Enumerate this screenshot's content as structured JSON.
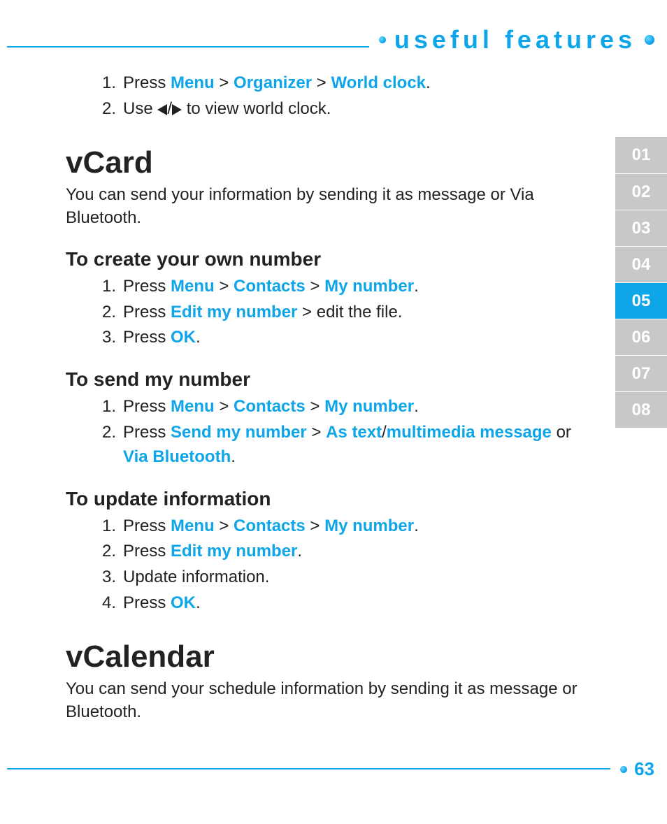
{
  "header": {
    "title": "useful features"
  },
  "intro_list": [
    {
      "n": "1.",
      "segments": [
        {
          "t": "Press ",
          "k": false
        },
        {
          "t": "Menu",
          "k": true
        },
        {
          "t": " > ",
          "k": false
        },
        {
          "t": "Organizer",
          "k": true
        },
        {
          "t": " > ",
          "k": false
        },
        {
          "t": "World clock",
          "k": true
        },
        {
          "t": ".",
          "k": false
        }
      ]
    },
    {
      "n": "2.",
      "segments": [
        {
          "t": "Use ",
          "k": false
        },
        {
          "icon": "tri-left"
        },
        {
          "t": "/",
          "k": false
        },
        {
          "icon": "tri-right"
        },
        {
          "t": " to view world clock.",
          "k": false
        }
      ]
    }
  ],
  "sections": [
    {
      "h1": "vCard",
      "desc": "You can send your information by sending it as message or Via Bluetooth.",
      "subs": [
        {
          "h2": "To create your own number",
          "items": [
            {
              "n": "1.",
              "segments": [
                {
                  "t": "Press ",
                  "k": false
                },
                {
                  "t": "Menu",
                  "k": true
                },
                {
                  "t": " > ",
                  "k": false
                },
                {
                  "t": "Contacts",
                  "k": true
                },
                {
                  "t": " > ",
                  "k": false
                },
                {
                  "t": "My number",
                  "k": true
                },
                {
                  "t": ".",
                  "k": false
                }
              ]
            },
            {
              "n": "2.",
              "segments": [
                {
                  "t": "Press ",
                  "k": false
                },
                {
                  "t": "Edit my number",
                  "k": true
                },
                {
                  "t": " > edit the file.",
                  "k": false
                }
              ]
            },
            {
              "n": "3.",
              "segments": [
                {
                  "t": "Press ",
                  "k": false
                },
                {
                  "t": "OK",
                  "k": true
                },
                {
                  "t": ".",
                  "k": false
                }
              ]
            }
          ]
        },
        {
          "h2": "To send my number",
          "items": [
            {
              "n": "1.",
              "segments": [
                {
                  "t": "Press ",
                  "k": false
                },
                {
                  "t": "Menu",
                  "k": true
                },
                {
                  "t": " > ",
                  "k": false
                },
                {
                  "t": "Contacts",
                  "k": true
                },
                {
                  "t": " > ",
                  "k": false
                },
                {
                  "t": "My number",
                  "k": true
                },
                {
                  "t": ".",
                  "k": false
                }
              ]
            },
            {
              "n": "2.",
              "segments": [
                {
                  "t": "Press ",
                  "k": false
                },
                {
                  "t": "Send my number",
                  "k": true
                },
                {
                  "t": " > ",
                  "k": false
                },
                {
                  "t": "As text",
                  "k": true
                },
                {
                  "t": "/",
                  "k": false
                },
                {
                  "t": "multimedia message",
                  "k": true
                },
                {
                  "t": " or ",
                  "k": false
                },
                {
                  "t": "Via Bluetooth",
                  "k": true
                },
                {
                  "t": ".",
                  "k": false
                }
              ]
            }
          ]
        },
        {
          "h2": "To update information",
          "items": [
            {
              "n": "1.",
              "segments": [
                {
                  "t": "Press ",
                  "k": false
                },
                {
                  "t": "Menu",
                  "k": true
                },
                {
                  "t": " > ",
                  "k": false
                },
                {
                  "t": "Contacts",
                  "k": true
                },
                {
                  "t": " > ",
                  "k": false
                },
                {
                  "t": "My number",
                  "k": true
                },
                {
                  "t": ".",
                  "k": false
                }
              ]
            },
            {
              "n": "2.",
              "segments": [
                {
                  "t": "Press ",
                  "k": false
                },
                {
                  "t": "Edit my number",
                  "k": true
                },
                {
                  "t": ".",
                  "k": false
                }
              ]
            },
            {
              "n": "3.",
              "segments": [
                {
                  "t": "Update information.",
                  "k": false
                }
              ]
            },
            {
              "n": "4.",
              "segments": [
                {
                  "t": "Press ",
                  "k": false
                },
                {
                  "t": "OK",
                  "k": true
                },
                {
                  "t": ".",
                  "k": false
                }
              ]
            }
          ]
        }
      ]
    },
    {
      "h1": "vCalendar",
      "desc": "You can send your schedule information by sending it as message or Bluetooth.",
      "subs": []
    }
  ],
  "tabs": [
    {
      "label": "01",
      "active": false
    },
    {
      "label": "02",
      "active": false
    },
    {
      "label": "03",
      "active": false
    },
    {
      "label": "04",
      "active": false
    },
    {
      "label": "05",
      "active": true
    },
    {
      "label": "06",
      "active": false
    },
    {
      "label": "07",
      "active": false
    },
    {
      "label": "08",
      "active": false
    }
  ],
  "footer": {
    "page": "63"
  }
}
